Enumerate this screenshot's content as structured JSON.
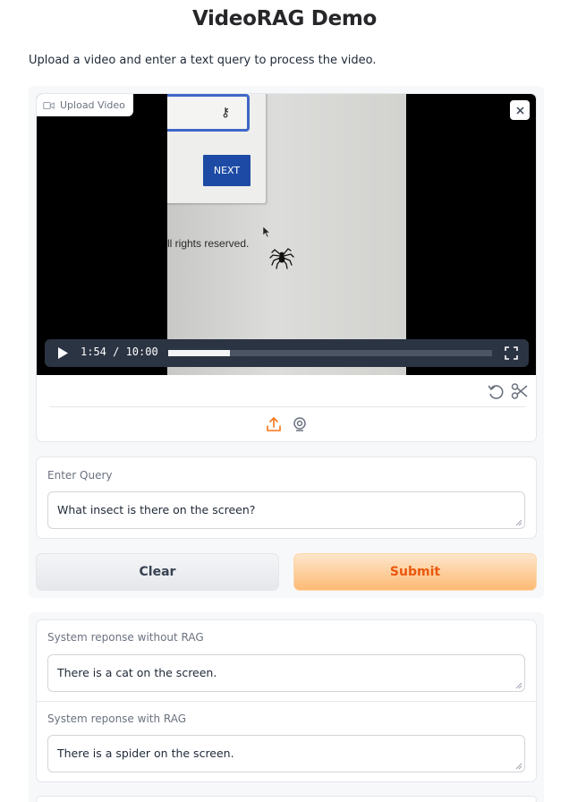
{
  "page": {
    "title": "VideoRAG Demo",
    "description": "Upload a video and enter a text query to process the video."
  },
  "video": {
    "label": "Upload Video",
    "current_time": "1:54",
    "duration": "10:00",
    "time_display": "1:54 / 10:00",
    "progress_fraction": 0.19,
    "frame": {
      "button_text": "NEXT",
      "footer_text": "ll rights reserved."
    }
  },
  "query": {
    "label": "Enter Query",
    "value": "What insect is there on the screen?"
  },
  "buttons": {
    "clear": "Clear",
    "submit": "Submit"
  },
  "responses": {
    "without_rag_label": "System reponse without RAG",
    "without_rag_value": "There is a cat on the screen.",
    "with_rag_label": "System reponse with RAG",
    "with_rag_value": "There is a spider on the screen."
  },
  "colors": {
    "accent": "#ea580c",
    "submit_bg": "#fdba74",
    "player_bar": "#2b3443",
    "frame_button": "#1d4aa5"
  },
  "icons": [
    "video-camera-icon",
    "close-icon",
    "play-icon",
    "fullscreen-icon",
    "undo-icon",
    "scissors-icon",
    "upload-icon",
    "webcam-icon"
  ]
}
